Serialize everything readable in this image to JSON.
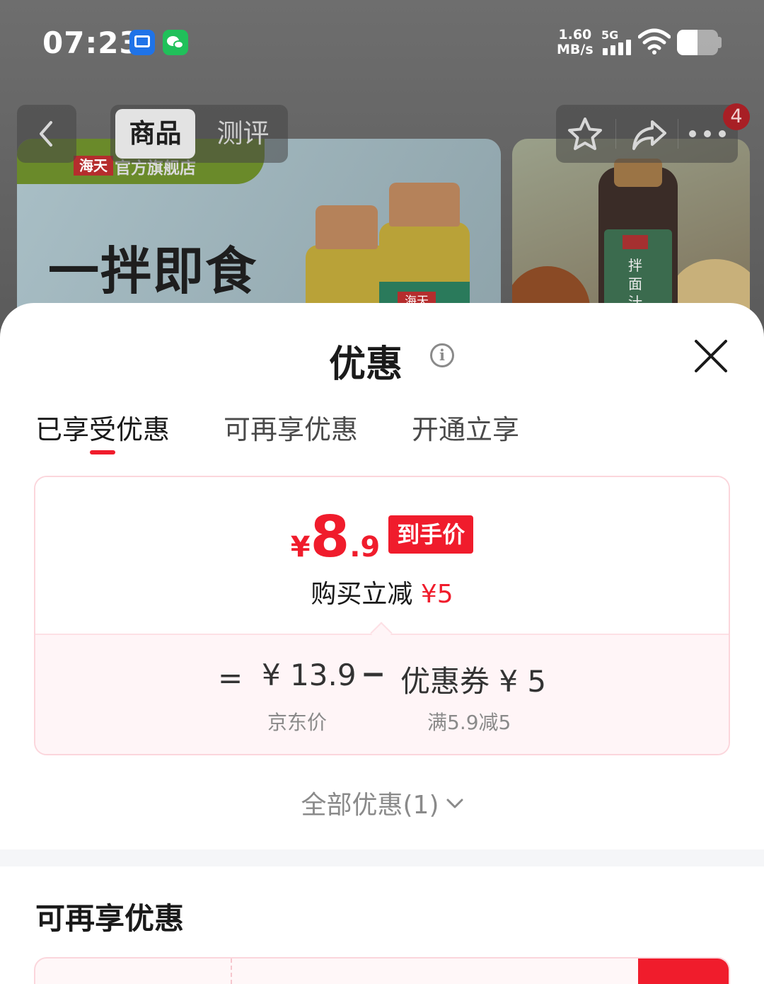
{
  "status_bar": {
    "time": "07:23",
    "net_speed_value": "1.60",
    "net_speed_unit": "MB/s",
    "network_type": "5G",
    "battery_percent": 50
  },
  "background_page": {
    "banner": {
      "brand_logo": "海天",
      "store_name": "官方旗舰店",
      "slogan": "一拌即食",
      "bottle_logo": "海天",
      "side_label": "拌面汁"
    },
    "nav": {
      "tabs": [
        {
          "label": "商品",
          "active": true
        },
        {
          "label": "测评",
          "active": false
        }
      ],
      "icons": [
        "back-icon",
        "star-icon",
        "share-icon",
        "more-icon"
      ],
      "notification_count": "4"
    }
  },
  "sheet": {
    "title": "优惠",
    "info_icon": "i",
    "tabs": [
      {
        "label": "已享受优惠",
        "active": true
      },
      {
        "label": "可再享优惠",
        "active": false
      },
      {
        "label": "开通立享",
        "active": false
      }
    ],
    "price_card": {
      "currency": "¥",
      "final_price_int": "8",
      "final_price_dec": ".9",
      "final_price_tag": "到手价",
      "discount_text": "购买立减",
      "discount_amount": "¥5",
      "equals": "=",
      "original_price": "¥ 13.9",
      "original_price_label": "京东价",
      "minus": "−",
      "coupon": "优惠券 ¥ 5",
      "coupon_condition": "满5.9减5"
    },
    "all_offers": "全部优惠(1)",
    "more_section_title": "可再享优惠"
  },
  "colors": {
    "accent": "#f01c2c",
    "card_border": "#fbd6dc",
    "card_bottom_bg": "#fff5f7",
    "muted_text": "#8a8a8a"
  }
}
